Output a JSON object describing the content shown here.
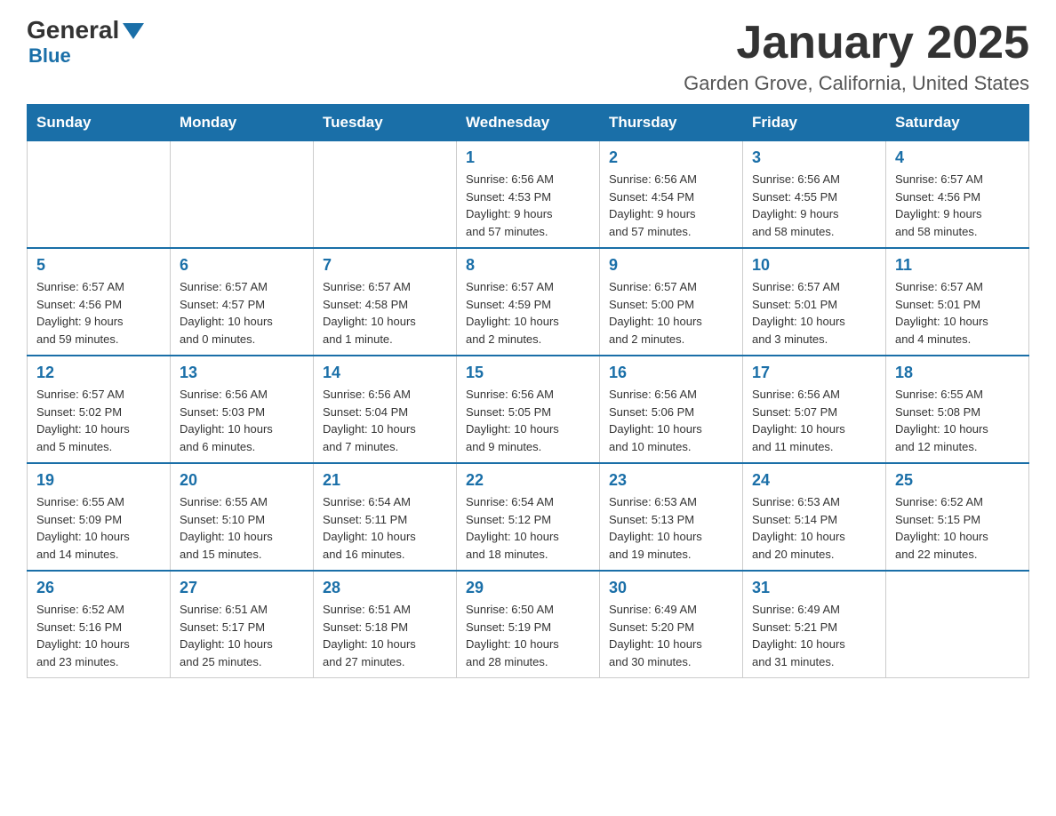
{
  "header": {
    "logo": {
      "general": "General",
      "blue": "Blue"
    },
    "title": "January 2025",
    "location": "Garden Grove, California, United States"
  },
  "days_of_week": [
    "Sunday",
    "Monday",
    "Tuesday",
    "Wednesday",
    "Thursday",
    "Friday",
    "Saturday"
  ],
  "weeks": [
    [
      {
        "day": "",
        "info": ""
      },
      {
        "day": "",
        "info": ""
      },
      {
        "day": "",
        "info": ""
      },
      {
        "day": "1",
        "info": "Sunrise: 6:56 AM\nSunset: 4:53 PM\nDaylight: 9 hours\nand 57 minutes."
      },
      {
        "day": "2",
        "info": "Sunrise: 6:56 AM\nSunset: 4:54 PM\nDaylight: 9 hours\nand 57 minutes."
      },
      {
        "day": "3",
        "info": "Sunrise: 6:56 AM\nSunset: 4:55 PM\nDaylight: 9 hours\nand 58 minutes."
      },
      {
        "day": "4",
        "info": "Sunrise: 6:57 AM\nSunset: 4:56 PM\nDaylight: 9 hours\nand 58 minutes."
      }
    ],
    [
      {
        "day": "5",
        "info": "Sunrise: 6:57 AM\nSunset: 4:56 PM\nDaylight: 9 hours\nand 59 minutes."
      },
      {
        "day": "6",
        "info": "Sunrise: 6:57 AM\nSunset: 4:57 PM\nDaylight: 10 hours\nand 0 minutes."
      },
      {
        "day": "7",
        "info": "Sunrise: 6:57 AM\nSunset: 4:58 PM\nDaylight: 10 hours\nand 1 minute."
      },
      {
        "day": "8",
        "info": "Sunrise: 6:57 AM\nSunset: 4:59 PM\nDaylight: 10 hours\nand 2 minutes."
      },
      {
        "day": "9",
        "info": "Sunrise: 6:57 AM\nSunset: 5:00 PM\nDaylight: 10 hours\nand 2 minutes."
      },
      {
        "day": "10",
        "info": "Sunrise: 6:57 AM\nSunset: 5:01 PM\nDaylight: 10 hours\nand 3 minutes."
      },
      {
        "day": "11",
        "info": "Sunrise: 6:57 AM\nSunset: 5:01 PM\nDaylight: 10 hours\nand 4 minutes."
      }
    ],
    [
      {
        "day": "12",
        "info": "Sunrise: 6:57 AM\nSunset: 5:02 PM\nDaylight: 10 hours\nand 5 minutes."
      },
      {
        "day": "13",
        "info": "Sunrise: 6:56 AM\nSunset: 5:03 PM\nDaylight: 10 hours\nand 6 minutes."
      },
      {
        "day": "14",
        "info": "Sunrise: 6:56 AM\nSunset: 5:04 PM\nDaylight: 10 hours\nand 7 minutes."
      },
      {
        "day": "15",
        "info": "Sunrise: 6:56 AM\nSunset: 5:05 PM\nDaylight: 10 hours\nand 9 minutes."
      },
      {
        "day": "16",
        "info": "Sunrise: 6:56 AM\nSunset: 5:06 PM\nDaylight: 10 hours\nand 10 minutes."
      },
      {
        "day": "17",
        "info": "Sunrise: 6:56 AM\nSunset: 5:07 PM\nDaylight: 10 hours\nand 11 minutes."
      },
      {
        "day": "18",
        "info": "Sunrise: 6:55 AM\nSunset: 5:08 PM\nDaylight: 10 hours\nand 12 minutes."
      }
    ],
    [
      {
        "day": "19",
        "info": "Sunrise: 6:55 AM\nSunset: 5:09 PM\nDaylight: 10 hours\nand 14 minutes."
      },
      {
        "day": "20",
        "info": "Sunrise: 6:55 AM\nSunset: 5:10 PM\nDaylight: 10 hours\nand 15 minutes."
      },
      {
        "day": "21",
        "info": "Sunrise: 6:54 AM\nSunset: 5:11 PM\nDaylight: 10 hours\nand 16 minutes."
      },
      {
        "day": "22",
        "info": "Sunrise: 6:54 AM\nSunset: 5:12 PM\nDaylight: 10 hours\nand 18 minutes."
      },
      {
        "day": "23",
        "info": "Sunrise: 6:53 AM\nSunset: 5:13 PM\nDaylight: 10 hours\nand 19 minutes."
      },
      {
        "day": "24",
        "info": "Sunrise: 6:53 AM\nSunset: 5:14 PM\nDaylight: 10 hours\nand 20 minutes."
      },
      {
        "day": "25",
        "info": "Sunrise: 6:52 AM\nSunset: 5:15 PM\nDaylight: 10 hours\nand 22 minutes."
      }
    ],
    [
      {
        "day": "26",
        "info": "Sunrise: 6:52 AM\nSunset: 5:16 PM\nDaylight: 10 hours\nand 23 minutes."
      },
      {
        "day": "27",
        "info": "Sunrise: 6:51 AM\nSunset: 5:17 PM\nDaylight: 10 hours\nand 25 minutes."
      },
      {
        "day": "28",
        "info": "Sunrise: 6:51 AM\nSunset: 5:18 PM\nDaylight: 10 hours\nand 27 minutes."
      },
      {
        "day": "29",
        "info": "Sunrise: 6:50 AM\nSunset: 5:19 PM\nDaylight: 10 hours\nand 28 minutes."
      },
      {
        "day": "30",
        "info": "Sunrise: 6:49 AM\nSunset: 5:20 PM\nDaylight: 10 hours\nand 30 minutes."
      },
      {
        "day": "31",
        "info": "Sunrise: 6:49 AM\nSunset: 5:21 PM\nDaylight: 10 hours\nand 31 minutes."
      },
      {
        "day": "",
        "info": ""
      }
    ]
  ]
}
